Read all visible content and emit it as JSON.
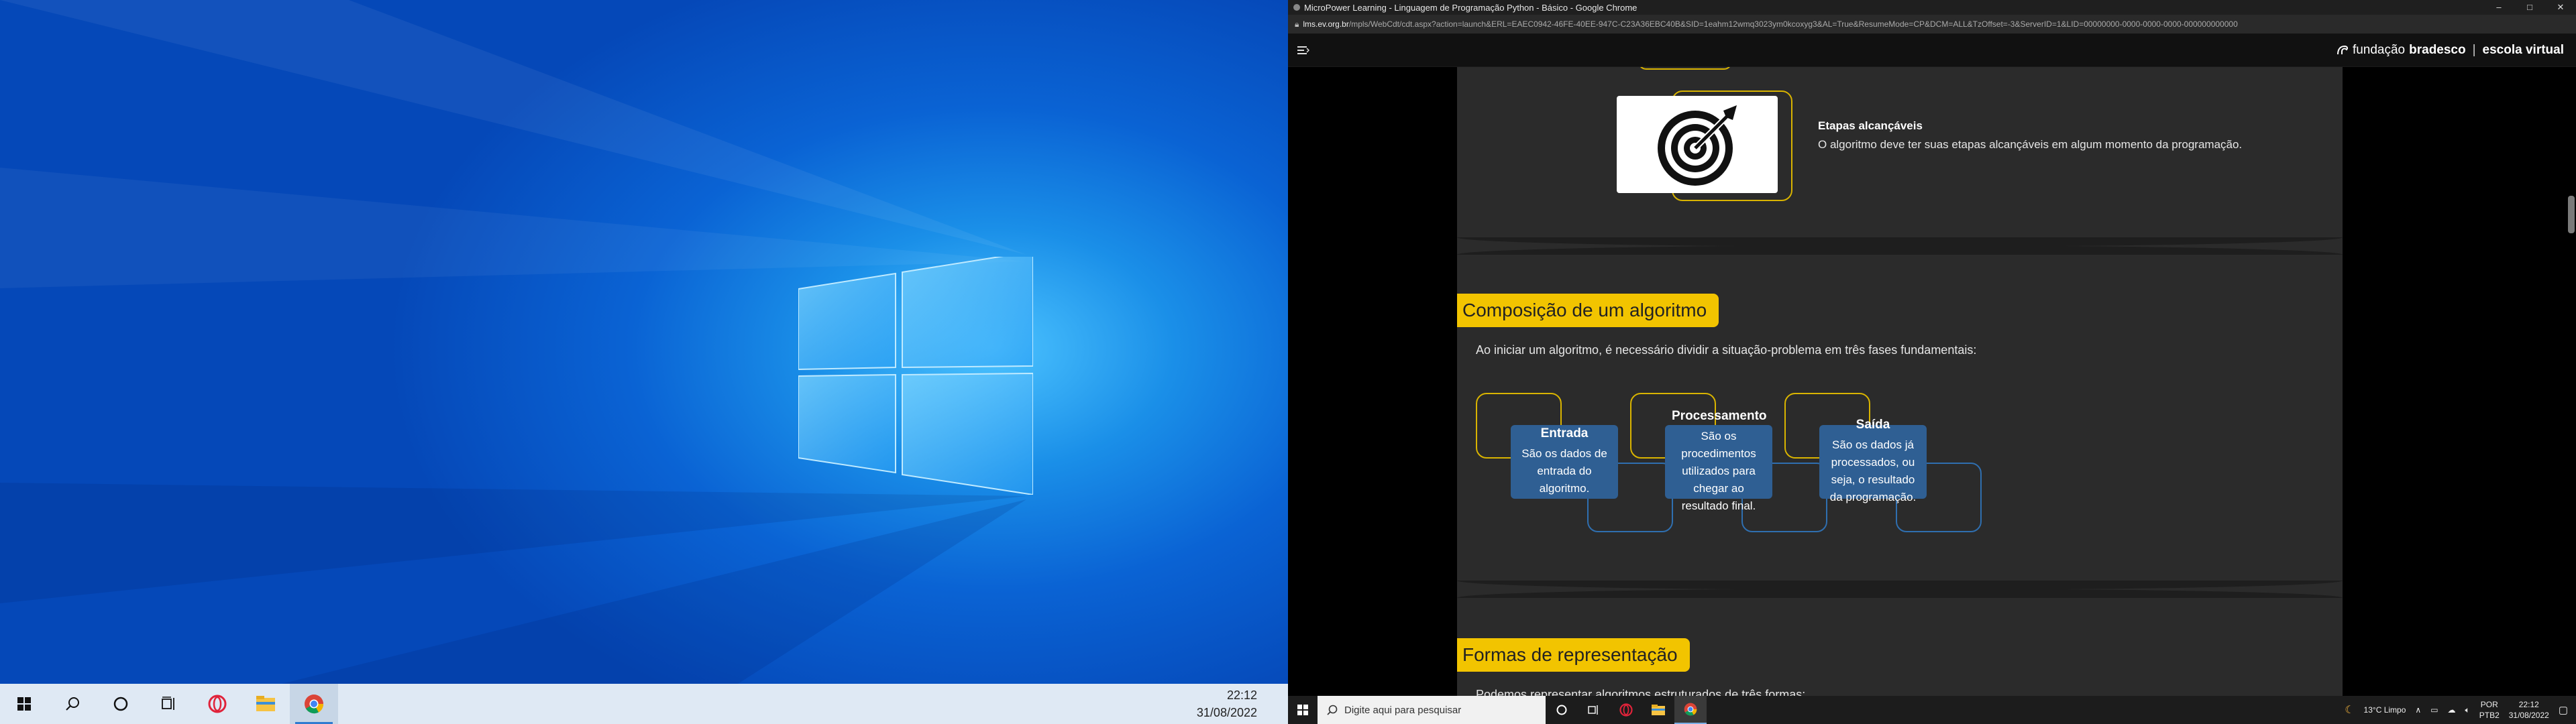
{
  "left_taskbar": {
    "time": "22:12",
    "date": "31/08/2022"
  },
  "browser": {
    "window_title": "MicroPower Learning - Linguagem de Programação Python - Básico - Google Chrome",
    "controls": {
      "minimize": "–",
      "maximize": "□",
      "close": "✕"
    },
    "url_domain": "lms.ev.org.br",
    "url_path": "/mpls/WebCdt/cdt.aspx?action=launch&ERL=EAEC0942-46FE-40EE-947C-C23A36EBC40B&SID=1eahm12wmq3023ym0kcoxyg3&AL=True&ResumeMode=CP&DCM=ALL&TzOffset=-3&ServerID=1&LID=00000000-0000-0000-0000-000000000000"
  },
  "header": {
    "brand_regular": "fundação",
    "brand_bold": "bradesco",
    "brand_separator": "|",
    "brand_product": "escola virtual"
  },
  "sections": {
    "goal": {
      "title": "Etapas alcançáveis",
      "text": "O algoritmo deve ter suas etapas alcançáveis em algum momento da programação."
    },
    "composition": {
      "heading": "Composição de um algoritmo",
      "intro": "Ao iniciar um algoritmo, é necessário dividir a situação-problema em três fases fundamentais:",
      "phases": [
        {
          "title": "Entrada",
          "text": "São os dados de entrada do algoritmo."
        },
        {
          "title": "Processamento",
          "text": "São os procedimentos utilizados para chegar ao resultado final."
        },
        {
          "title": "Saída",
          "text": "São os dados já processados, ou seja, o resultado da programação."
        }
      ]
    },
    "representation": {
      "heading": "Formas de representação",
      "partial_text": "Podemos representar algoritmos estruturados de três formas:"
    }
  },
  "right_taskbar": {
    "search_placeholder": "Digite aqui para pesquisar",
    "weather": "13°C  Limpo",
    "lang_top": "POR",
    "lang_bottom": "PTB2",
    "time": "22:12",
    "date": "31/08/2022"
  }
}
